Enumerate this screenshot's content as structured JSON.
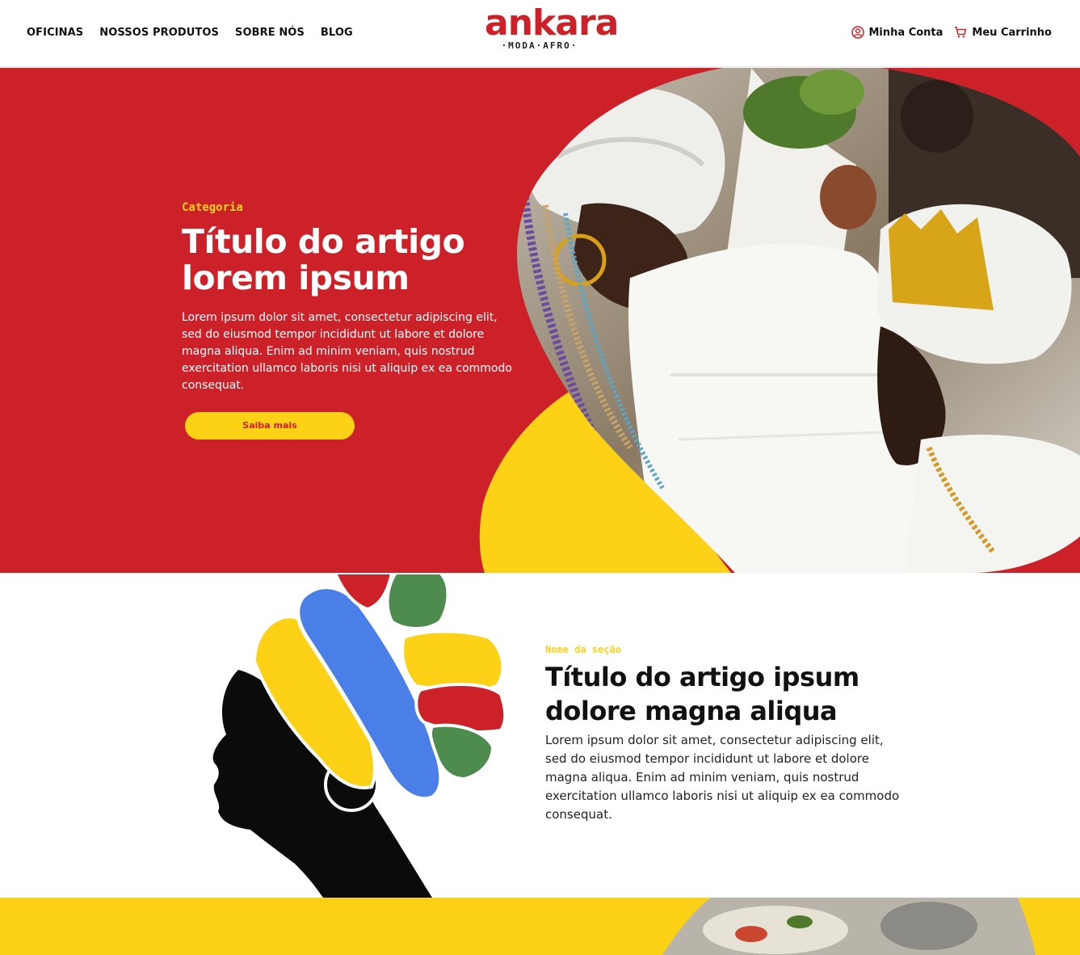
{
  "header": {
    "nav": [
      "OFICINAS",
      "NOSSOS PRODUTOS",
      "SOBRE NÓS",
      "BLOG"
    ],
    "logo": {
      "word": "ankara",
      "tagline": "·MODA·AFRO·"
    },
    "account_label": "Minha Conta",
    "cart_label": "Meu Carrinho"
  },
  "hero": {
    "category": "Categoria",
    "title": "Título do artigo lorem ipsum",
    "description": "Lorem ipsum dolor sit amet, consectetur adipiscing elit, sed do eiusmod tempor incididunt ut labore et dolore magna aliqua. Enim ad minim veniam, quis nostrud exercitation ullamco laboris nisi ut aliquip ex ea commodo consequat.",
    "button_label": "Saiba mais"
  },
  "section2": {
    "category": "Nome da seção",
    "title": "Título do artigo ipsum dolore magna aliqua",
    "description": "Lorem ipsum dolor sit amet, consectetur adipiscing elit, sed do eiusmod tempor incididunt ut labore et dolore magna aliqua. Enim ad minim veniam, quis nostrud exercitation ullamco laboris nisi ut aliquip ex ea commodo consequat."
  },
  "colors": {
    "brand_red": "#cc2129",
    "brand_yellow": "#fcd116",
    "brand_blue": "#4a7fe8",
    "brand_green": "#4e8b4e"
  },
  "icons": {
    "account": "user-circle-icon",
    "cart": "cart-icon"
  }
}
